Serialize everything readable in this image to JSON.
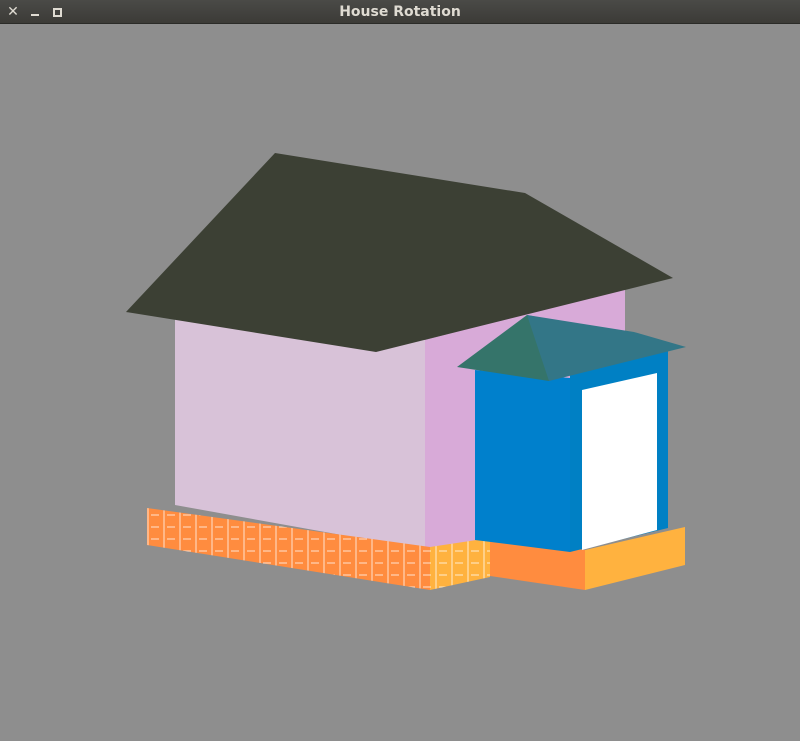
{
  "window": {
    "title": "House Rotation",
    "controls": {
      "close": "close-icon",
      "minimize": "minimize-icon",
      "maximize": "maximize-icon"
    }
  },
  "colors": {
    "background": "#8e8e8e",
    "roof": "#3c4034",
    "wall_front": "#d8c2d8",
    "wall_side": "#d8aad8",
    "foundation_front": "#ff8c3f",
    "foundation_side": "#ffb23f",
    "porch_wall": "#0080cc",
    "porch_roof_front": "#35746a",
    "porch_roof_side": "#337687",
    "door": "#ffffff"
  }
}
